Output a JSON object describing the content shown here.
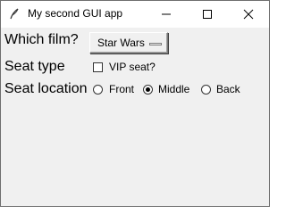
{
  "window": {
    "title": "My second GUI app",
    "controls": {
      "minimize": "minimize",
      "maximize": "maximize",
      "close": "close"
    }
  },
  "form": {
    "film_label": "Which film?",
    "film_selected": "Star Wars",
    "seat_type_label": "Seat type",
    "vip_label": "VIP seat?",
    "vip_checked": false,
    "seat_location_label": "Seat location",
    "locations": [
      "Front",
      "Middle",
      "Back"
    ],
    "location_selected": "Middle"
  },
  "icons": {
    "app": "feather-icon",
    "minimize": "minimize-icon",
    "maximize": "maximize-icon",
    "close": "close-icon"
  }
}
